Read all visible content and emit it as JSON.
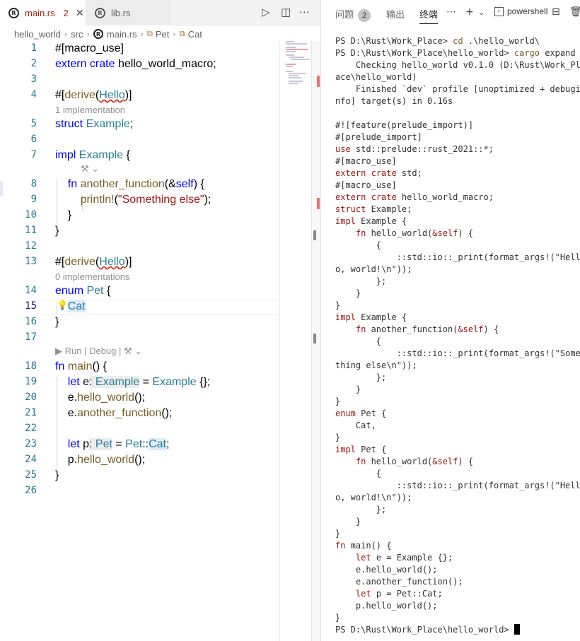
{
  "tabs": [
    {
      "label": "main.rs",
      "problems": "2",
      "close": "✕",
      "active": true
    },
    {
      "label": "lib.rs",
      "active": false
    }
  ],
  "breadcrumb": [
    "hello_world",
    "src",
    "main.rs",
    "Pet",
    "Cat"
  ],
  "code_lines": [
    {
      "n": "1",
      "text": "#[macro_use]"
    },
    {
      "n": "2",
      "text": "extern crate hello_world_macro;"
    },
    {
      "n": "3",
      "text": ""
    },
    {
      "n": "4",
      "text": "#[derive(Hello)]"
    },
    {
      "n": "5",
      "text": "struct Example;"
    },
    {
      "n": "6",
      "text": ""
    },
    {
      "n": "7",
      "text": "impl Example {"
    },
    {
      "n": "8",
      "text": "    fn another_function(&self) {"
    },
    {
      "n": "9",
      "text": "        println!(\"Something else\");"
    },
    {
      "n": "10",
      "text": "    }"
    },
    {
      "n": "11",
      "text": "}"
    },
    {
      "n": "12",
      "text": ""
    },
    {
      "n": "13",
      "text": "#[derive(Hello)]"
    },
    {
      "n": "14",
      "text": "enum Pet {"
    },
    {
      "n": "15",
      "text": "    Cat"
    },
    {
      "n": "16",
      "text": "}"
    },
    {
      "n": "17",
      "text": ""
    },
    {
      "n": "18",
      "text": "fn main() {"
    },
    {
      "n": "19",
      "text": "    let e: Example = Example {};"
    },
    {
      "n": "20",
      "text": "    e.hello_world();"
    },
    {
      "n": "21",
      "text": "    e.another_function();"
    },
    {
      "n": "22",
      "text": ""
    },
    {
      "n": "23",
      "text": "    let p: Pet = Pet::Cat;"
    },
    {
      "n": "24",
      "text": "    p.hello_world();"
    },
    {
      "n": "25",
      "text": "}"
    },
    {
      "n": "26",
      "text": ""
    }
  ],
  "lenses": {
    "impl_count_1": "1 implementation",
    "impl_count_0": "0 implementations",
    "run": "▶ Run",
    "debug": "Debug"
  },
  "panel": {
    "tabs": [
      "问题",
      "输出",
      "终端"
    ],
    "problems_count": "2",
    "terminal_name": "powershell"
  },
  "terminal_lines": [
    "PS D:\\Rust\\Work_Place> cd .\\hello_world\\",
    "PS D:\\Rust\\Work_Place\\hello_world> cargo expand",
    "    Checking hello_world v0.1.0 (D:\\Rust\\Work_Pl",
    "ace\\hello_world)",
    "    Finished `dev` profile [unoptimized + debugi",
    "nfo] target(s) in 0.16s",
    "",
    "#![feature(prelude_import)]",
    "#[prelude_import]",
    "use std::prelude::rust_2021::*;",
    "#[macro_use]",
    "extern crate std;",
    "#[macro_use]",
    "extern crate hello_world_macro;",
    "struct Example;",
    "impl Example {",
    "    fn hello_world(&self) {",
    "        {",
    "            ::std::io::_print(format_args!(\"Hell",
    "o, world!\\n\"));",
    "        };",
    "    }",
    "}",
    "impl Example {",
    "    fn another_function(&self) {",
    "        {",
    "            ::std::io::_print(format_args!(\"Some",
    "thing else\\n\"));",
    "        };",
    "    }",
    "}",
    "enum Pet {",
    "    Cat,",
    "}",
    "impl Pet {",
    "    fn hello_world(&self) {",
    "        {",
    "            ::std::io::_print(format_args!(\"Hell",
    "o, world!\\n\"));",
    "        };",
    "    }",
    "}",
    "fn main() {",
    "    let e = Example {};",
    "    e.hello_world();",
    "    e.another_function();",
    "    let p = Pet::Cat;",
    "    p.hello_world();",
    "}",
    "PS D:\\Rust\\Work_Place\\hello_world> "
  ],
  "icons": [
    "rust-icon",
    "close-icon",
    "run-icon",
    "split-editor-icon",
    "more-icon",
    "add-terminal-icon",
    "chevron-down-icon",
    "maximize-panel-icon",
    "trash-icon",
    "lightbulb-icon",
    "enum-member-icon"
  ]
}
